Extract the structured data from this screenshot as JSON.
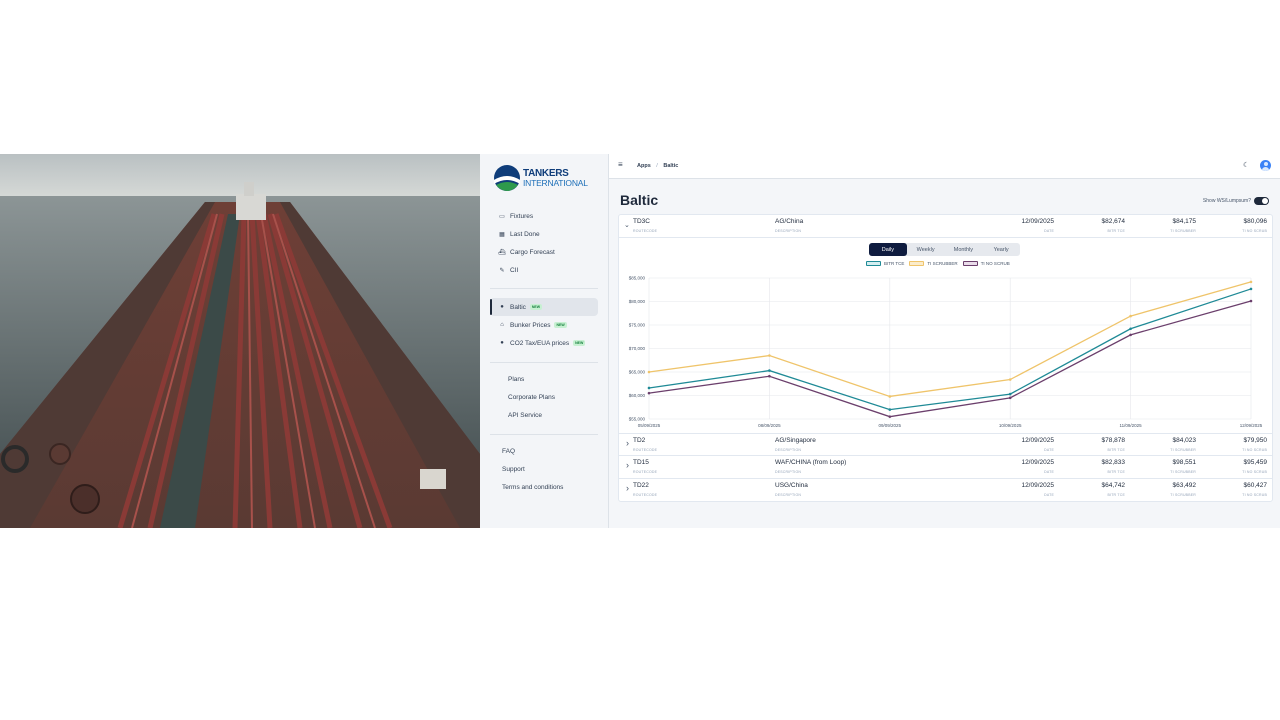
{
  "brand": {
    "line1": "TANKERS",
    "line2": "INTERNATIONAL",
    "colors": {
      "navy": "#0f3d7a",
      "green": "#2e9a4c"
    }
  },
  "sidebar": {
    "group1": [
      {
        "label": "Fixtures",
        "icon": "table-icon"
      },
      {
        "label": "Last Done",
        "icon": "calendar-icon"
      },
      {
        "label": "Cargo Forecast",
        "icon": "ship-icon"
      },
      {
        "label": "CII",
        "icon": "leaf-icon"
      }
    ],
    "group2": [
      {
        "label": "Baltic",
        "icon": "globe-icon",
        "badge": "NEW",
        "active": true
      },
      {
        "label": "Bunker Prices",
        "icon": "tag-icon",
        "badge": "NEW"
      },
      {
        "label": "CO2 Tax/EUA prices",
        "icon": "drop-icon",
        "badge": "NEW"
      }
    ],
    "group3": [
      {
        "label": "Plans"
      },
      {
        "label": "Corporate Plans"
      },
      {
        "label": "API Service"
      }
    ],
    "group4": [
      {
        "label": "FAQ"
      },
      {
        "label": "Support"
      },
      {
        "label": "Terms and conditions"
      }
    ]
  },
  "topbar": {
    "crumb1": "Apps",
    "sep": "/",
    "crumb2": "Baltic"
  },
  "page": {
    "title": "Baltic",
    "toggle_label": "Show WS/Lumpsum?",
    "toggle_on": true
  },
  "headers": {
    "code": "ROUTECODE",
    "desc": "DESCRIPTION",
    "date": "DATE",
    "bitr": "BITR TCE",
    "scrub": "TI SCRUBBER",
    "noscrub": "TI NO SCRUB"
  },
  "routes": [
    {
      "code": "TD3C",
      "desc": "AG/China",
      "date": "12/09/2025",
      "bitr": "$82,674",
      "scrub": "$84,175",
      "noscrub": "$80,096",
      "expanded": true
    },
    {
      "code": "TD2",
      "desc": "AG/Singapore",
      "date": "12/09/2025",
      "bitr": "$78,878",
      "scrub": "$84,023",
      "noscrub": "$79,950"
    },
    {
      "code": "TD15",
      "desc": "WAF/CHINA (from Loop)",
      "date": "12/09/2025",
      "bitr": "$82,833",
      "scrub": "$98,551",
      "noscrub": "$95,459"
    },
    {
      "code": "TD22",
      "desc": "USG/China",
      "date": "12/09/2025",
      "bitr": "$64,742",
      "scrub": "$63,492",
      "noscrub": "$60,427"
    }
  ],
  "tabs": [
    "Daily",
    "Weekly",
    "Monthly",
    "Yearly"
  ],
  "active_tab": "Daily",
  "chart_data": {
    "type": "line",
    "x": [
      "05/09/2025",
      "08/09/2025",
      "09/09/2025",
      "10/09/2025",
      "11/09/2025",
      "12/09/2025"
    ],
    "y_ticks": [
      "$55,000",
      "$60,000",
      "$65,000",
      "$70,000",
      "$75,000",
      "$80,000",
      "$85,000"
    ],
    "ylim": [
      55000,
      85000
    ],
    "grid": true,
    "legend_position": "top-center",
    "series": [
      {
        "name": "BITR TCE",
        "color": "#1f8a96",
        "values": [
          61600,
          65300,
          57000,
          60300,
          74200,
          82674
        ]
      },
      {
        "name": "TI SCRUBBER",
        "color": "#efc46a",
        "values": [
          65000,
          68500,
          59800,
          63400,
          76900,
          84175
        ]
      },
      {
        "name": "TI NO SCRUB",
        "color": "#6b3f6c",
        "values": [
          60500,
          64100,
          55500,
          59500,
          72900,
          80096
        ]
      }
    ]
  }
}
